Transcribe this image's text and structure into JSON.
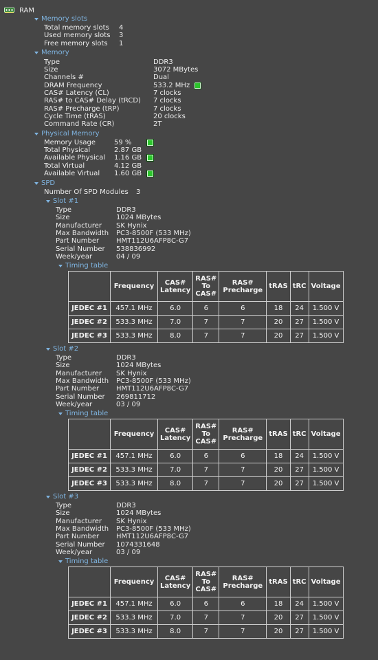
{
  "root_label": "RAM",
  "memory_slots": {
    "label": "Memory slots",
    "rows": [
      {
        "key": "Total memory slots",
        "value": "4"
      },
      {
        "key": "Used memory slots",
        "value": "3"
      },
      {
        "key": "Free memory slots",
        "value": "1"
      }
    ]
  },
  "memory": {
    "label": "Memory",
    "rows": [
      {
        "key": "Type",
        "value": "DDR3"
      },
      {
        "key": "Size",
        "value": "3072 MBytes"
      },
      {
        "key": "Channels #",
        "value": "Dual"
      },
      {
        "key": "DRAM Frequency",
        "value": "533.2 MHz",
        "indicator": true
      },
      {
        "key": "CAS# Latency (CL)",
        "value": "7 clocks"
      },
      {
        "key": "RAS# to CAS# Delay (tRCD)",
        "value": "7 clocks"
      },
      {
        "key": "RAS# Precharge (tRP)",
        "value": "7 clocks"
      },
      {
        "key": "Cycle Time (tRAS)",
        "value": "20 clocks"
      },
      {
        "key": "Command Rate (CR)",
        "value": "2T"
      }
    ]
  },
  "physical_memory": {
    "label": "Physical Memory",
    "rows": [
      {
        "key": "Memory Usage",
        "value": "59 %",
        "indicator": true
      },
      {
        "key": "Total Physical",
        "value": "2.87 GB"
      },
      {
        "key": "Available Physical",
        "value": "1.16 GB",
        "indicator": true
      },
      {
        "key": "Total Virtual",
        "value": "4.12 GB"
      },
      {
        "key": "Available Virtual",
        "value": "1.60 GB",
        "indicator": true
      }
    ]
  },
  "spd": {
    "label": "SPD",
    "modules_key": "Number Of SPD Modules",
    "modules_value": "3",
    "timing_label": "Timing table",
    "table_headers": [
      [
        "Frequency"
      ],
      [
        "CAS#",
        "Latency"
      ],
      [
        "RAS#",
        "To",
        "CAS#"
      ],
      [
        "RAS#",
        "Precharge"
      ],
      [
        "tRAS"
      ],
      [
        "tRC"
      ],
      [
        "Voltage"
      ]
    ],
    "slots": [
      {
        "label": "Slot #1",
        "info": [
          {
            "key": "Type",
            "value": "DDR3"
          },
          {
            "key": "Size",
            "value": "1024 MBytes"
          },
          {
            "key": "Manufacturer",
            "value": "SK Hynix"
          },
          {
            "key": "Max Bandwidth",
            "value": "PC3-8500F (533 MHz)"
          },
          {
            "key": "Part Number",
            "value": "HMT112U6AFP8C-G7"
          },
          {
            "key": "Serial Number",
            "value": "538836992"
          },
          {
            "key": "Week/year",
            "value": "04 / 09"
          }
        ],
        "timings": [
          {
            "name": "JEDEC #1",
            "cells": [
              "457.1 MHz",
              "6.0",
              "6",
              "6",
              "18",
              "24",
              "1.500 V"
            ]
          },
          {
            "name": "JEDEC #2",
            "cells": [
              "533.3 MHz",
              "7.0",
              "7",
              "7",
              "20",
              "27",
              "1.500 V"
            ]
          },
          {
            "name": "JEDEC #3",
            "cells": [
              "533.3 MHz",
              "8.0",
              "7",
              "7",
              "20",
              "27",
              "1.500 V"
            ]
          }
        ]
      },
      {
        "label": "Slot #2",
        "info": [
          {
            "key": "Type",
            "value": "DDR3"
          },
          {
            "key": "Size",
            "value": "1024 MBytes"
          },
          {
            "key": "Manufacturer",
            "value": "SK Hynix"
          },
          {
            "key": "Max Bandwidth",
            "value": "PC3-8500F (533 MHz)"
          },
          {
            "key": "Part Number",
            "value": "HMT112U6AFP8C-G7"
          },
          {
            "key": "Serial Number",
            "value": "269811712"
          },
          {
            "key": "Week/year",
            "value": "03 / 09"
          }
        ],
        "timings": [
          {
            "name": "JEDEC #1",
            "cells": [
              "457.1 MHz",
              "6.0",
              "6",
              "6",
              "18",
              "24",
              "1.500 V"
            ]
          },
          {
            "name": "JEDEC #2",
            "cells": [
              "533.3 MHz",
              "7.0",
              "7",
              "7",
              "20",
              "27",
              "1.500 V"
            ]
          },
          {
            "name": "JEDEC #3",
            "cells": [
              "533.3 MHz",
              "8.0",
              "7",
              "7",
              "20",
              "27",
              "1.500 V"
            ]
          }
        ]
      },
      {
        "label": "Slot #3",
        "info": [
          {
            "key": "Type",
            "value": "DDR3"
          },
          {
            "key": "Size",
            "value": "1024 MBytes"
          },
          {
            "key": "Manufacturer",
            "value": "SK Hynix"
          },
          {
            "key": "Max Bandwidth",
            "value": "PC3-8500F (533 MHz)"
          },
          {
            "key": "Part Number",
            "value": "HMT112U6AFP8C-G7"
          },
          {
            "key": "Serial Number",
            "value": "1074331648"
          },
          {
            "key": "Week/year",
            "value": "03 / 09"
          }
        ],
        "timings": [
          {
            "name": "JEDEC #1",
            "cells": [
              "457.1 MHz",
              "6.0",
              "6",
              "6",
              "18",
              "24",
              "1.500 V"
            ]
          },
          {
            "name": "JEDEC #2",
            "cells": [
              "533.3 MHz",
              "7.0",
              "7",
              "7",
              "20",
              "27",
              "1.500 V"
            ]
          },
          {
            "name": "JEDEC #3",
            "cells": [
              "533.3 MHz",
              "8.0",
              "7",
              "7",
              "20",
              "27",
              "1.500 V"
            ]
          }
        ]
      }
    ]
  },
  "colors": {
    "background": "#464646",
    "text": "#ececec",
    "section_header": "#7fb4e0",
    "indicator": "#2cc62c",
    "table_border": "#cfcfcf"
  },
  "icons": {
    "root": "ram-module-icon",
    "expand": "expand-triangle-icon",
    "status": "green-status-indicator-icon"
  }
}
